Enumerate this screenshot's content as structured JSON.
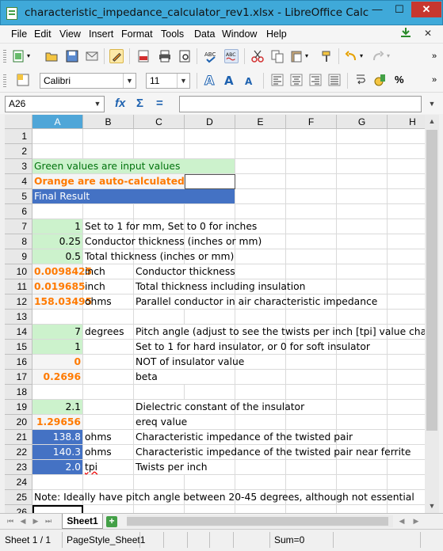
{
  "window": {
    "title": "characteristic_impedance_calculator_rev1.xlsx - LibreOffice Calc",
    "minimize": "—",
    "maximize": "☐",
    "close": "✕"
  },
  "menu": [
    "File",
    "Edit",
    "View",
    "Insert",
    "Format",
    "Tools",
    "Data",
    "Window",
    "Help"
  ],
  "toolbar": {
    "font_name": "Calibri",
    "font_size": "11"
  },
  "formula_bar": {
    "cell_ref": "A26",
    "formula": ""
  },
  "columns": [
    "A",
    "B",
    "C",
    "D",
    "E",
    "F",
    "G",
    "H"
  ],
  "rows": [
    {
      "n": "1",
      "a": "",
      "b": "",
      "c": ""
    },
    {
      "n": "2",
      "a": "",
      "b": "",
      "c": ""
    },
    {
      "n": "3",
      "a": "Green values are input values",
      "b": "",
      "c": ""
    },
    {
      "n": "4",
      "a": "Orange are auto-calculated",
      "b": "",
      "c": ""
    },
    {
      "n": "5",
      "a": "Final Result",
      "b": "",
      "c": ""
    },
    {
      "n": "6",
      "a": "",
      "b": "",
      "c": ""
    },
    {
      "n": "7",
      "a": "1",
      "b": "Set to 1 for mm, Set to 0 for inches",
      "c": ""
    },
    {
      "n": "8",
      "a": "0.25",
      "b": "Conductor thickness (inches or mm)",
      "c": ""
    },
    {
      "n": "9",
      "a": "0.5",
      "b": "Total thickness (inches or mm)",
      "c": ""
    },
    {
      "n": "10",
      "a": "0.0098425",
      "b": "inch",
      "c": "Conductor thickness"
    },
    {
      "n": "11",
      "a": "0.019685",
      "b": "inch",
      "c": "Total thickness including insulation"
    },
    {
      "n": "12",
      "a": "158.03495",
      "b": "ohms",
      "c": "Parallel conductor in air characteristic impedance"
    },
    {
      "n": "13",
      "a": "",
      "b": "",
      "c": ""
    },
    {
      "n": "14",
      "a": "7",
      "b": "degrees",
      "c": "Pitch angle (adjust to see the twists per inch [tpi] value cha"
    },
    {
      "n": "15",
      "a": "1",
      "b": "",
      "c": "Set to 1 for hard insulator, or 0 for soft insulator"
    },
    {
      "n": "16",
      "a": "0",
      "b": "",
      "c": "NOT of insulator value"
    },
    {
      "n": "17",
      "a": "0.2696",
      "b": "",
      "c": "beta"
    },
    {
      "n": "18",
      "a": "",
      "b": "",
      "c": ""
    },
    {
      "n": "19",
      "a": "2.1",
      "b": "",
      "c": "Dielectric constant of the insulator"
    },
    {
      "n": "20",
      "a": "1.29656",
      "b": "",
      "c": "ereq value"
    },
    {
      "n": "21",
      "a": "138.8",
      "b": "ohms",
      "c": "Characteristic impedance of the twisted pair"
    },
    {
      "n": "22",
      "a": "140.3",
      "b": "ohms",
      "c": "Characteristic impedance of the twisted pair near ferrite"
    },
    {
      "n": "23",
      "a": "2.0",
      "b": "tpi",
      "c": "Twists per inch"
    },
    {
      "n": "24",
      "a": "",
      "b": "",
      "c": ""
    },
    {
      "n": "25",
      "a": "Note: Ideally have pitch angle between 20-45 degrees, although not essential",
      "b": "",
      "c": ""
    },
    {
      "n": "26",
      "a": "",
      "b": "",
      "c": ""
    }
  ],
  "sheet_tab": "Sheet1",
  "status": {
    "sheet": "Sheet 1 / 1",
    "page_style": "PageStyle_Sheet1",
    "sum": "Sum=0"
  },
  "colors": {
    "title_bar": "#3fa9d9",
    "input_green": "#ccf2cc",
    "auto_orange": "#ff7a00",
    "result_blue": "#4472c4",
    "selected_col": "#4fa6d8"
  }
}
